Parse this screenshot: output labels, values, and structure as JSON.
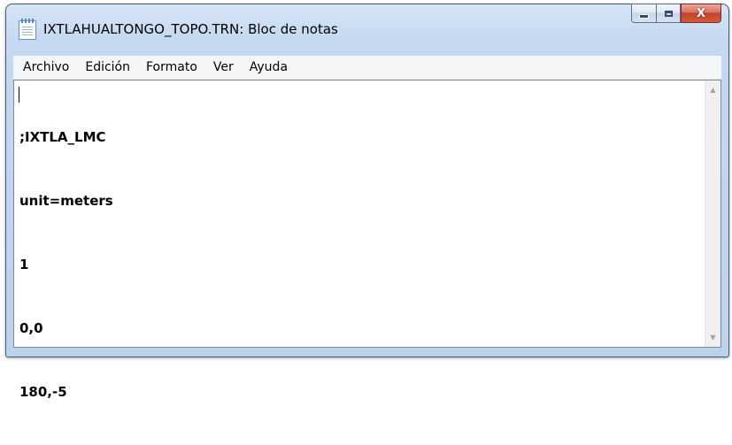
{
  "window": {
    "title": "IXTLAHUALTONGO_TOPO.TRN: Bloc de notas",
    "icon": "notepad-icon",
    "buttons": {
      "minimize": "minimize-icon",
      "maximize": "maximize-icon",
      "close": "close-icon"
    }
  },
  "menu": {
    "items": [
      "Archivo",
      "Edición",
      "Formato",
      "Ver",
      "Ayuda"
    ]
  },
  "editor": {
    "lines": [
      ";IXTLA_LMC",
      "unit=meters",
      "1",
      "0,0",
      "180,-5"
    ]
  },
  "scrollbar": {
    "up_glyph": "▲",
    "down_glyph": "▼"
  },
  "colors": {
    "frame": "#bcd3ed",
    "close_button": "#c1412d",
    "menu_background": "#f5f6f7",
    "editor_background": "#ffffff"
  }
}
